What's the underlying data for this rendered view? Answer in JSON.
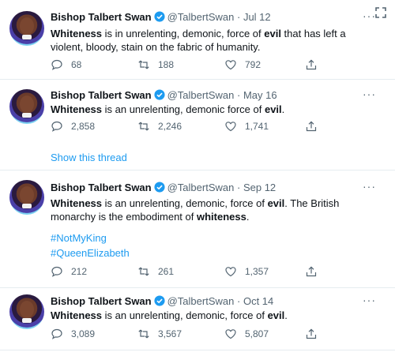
{
  "colors": {
    "accent": "#1d9bf0",
    "muted": "#536471",
    "text": "#0f1419",
    "verified": "#1d9bf0"
  },
  "corner_icon": "expand-icon",
  "tweets": [
    {
      "name": "Bishop Talbert Swan",
      "handle": "@TalbertSwan",
      "sep": "·",
      "date": "Jul 12",
      "text": [
        {
          "t": "Whiteness",
          "b": true
        },
        {
          "t": " is in unrelenting, demonic, force of "
        },
        {
          "t": "evil",
          "b": true
        },
        {
          "t": " that has left a violent, bloody, stain on the fabric of humanity."
        }
      ],
      "replies": "68",
      "retweets": "188",
      "likes": "792"
    },
    {
      "name": "Bishop Talbert Swan",
      "handle": "@TalbertSwan",
      "sep": "·",
      "date": "May 16",
      "text": [
        {
          "t": "Whiteness",
          "b": true
        },
        {
          "t": " is an unrelenting, demonic force of "
        },
        {
          "t": "evil",
          "b": true
        },
        {
          "t": "."
        }
      ],
      "replies": "2,858",
      "retweets": "2,246",
      "likes": "1,741",
      "show_thread": "Show this thread"
    },
    {
      "name": "Bishop Talbert Swan",
      "handle": "@TalbertSwan",
      "sep": "·",
      "date": "Sep 12",
      "text": [
        {
          "t": "Whiteness",
          "b": true
        },
        {
          "t": " is an unrelenting, demonic, force of "
        },
        {
          "t": "evil",
          "b": true
        },
        {
          "t": ". The British monarchy is the embodiment of "
        },
        {
          "t": "whiteness",
          "b": true
        },
        {
          "t": "."
        }
      ],
      "hashtags": [
        "#NotMyKing",
        "#QueenElizabeth"
      ],
      "replies": "212",
      "retweets": "261",
      "likes": "1,357"
    },
    {
      "name": "Bishop Talbert Swan",
      "handle": "@TalbertSwan",
      "sep": "·",
      "date": "Oct 14",
      "text": [
        {
          "t": "Whiteness",
          "b": true
        },
        {
          "t": " is an unrelenting, demonic, force of "
        },
        {
          "t": "evil",
          "b": true
        },
        {
          "t": "."
        }
      ],
      "replies": "3,089",
      "retweets": "3,567",
      "likes": "5,807"
    }
  ]
}
